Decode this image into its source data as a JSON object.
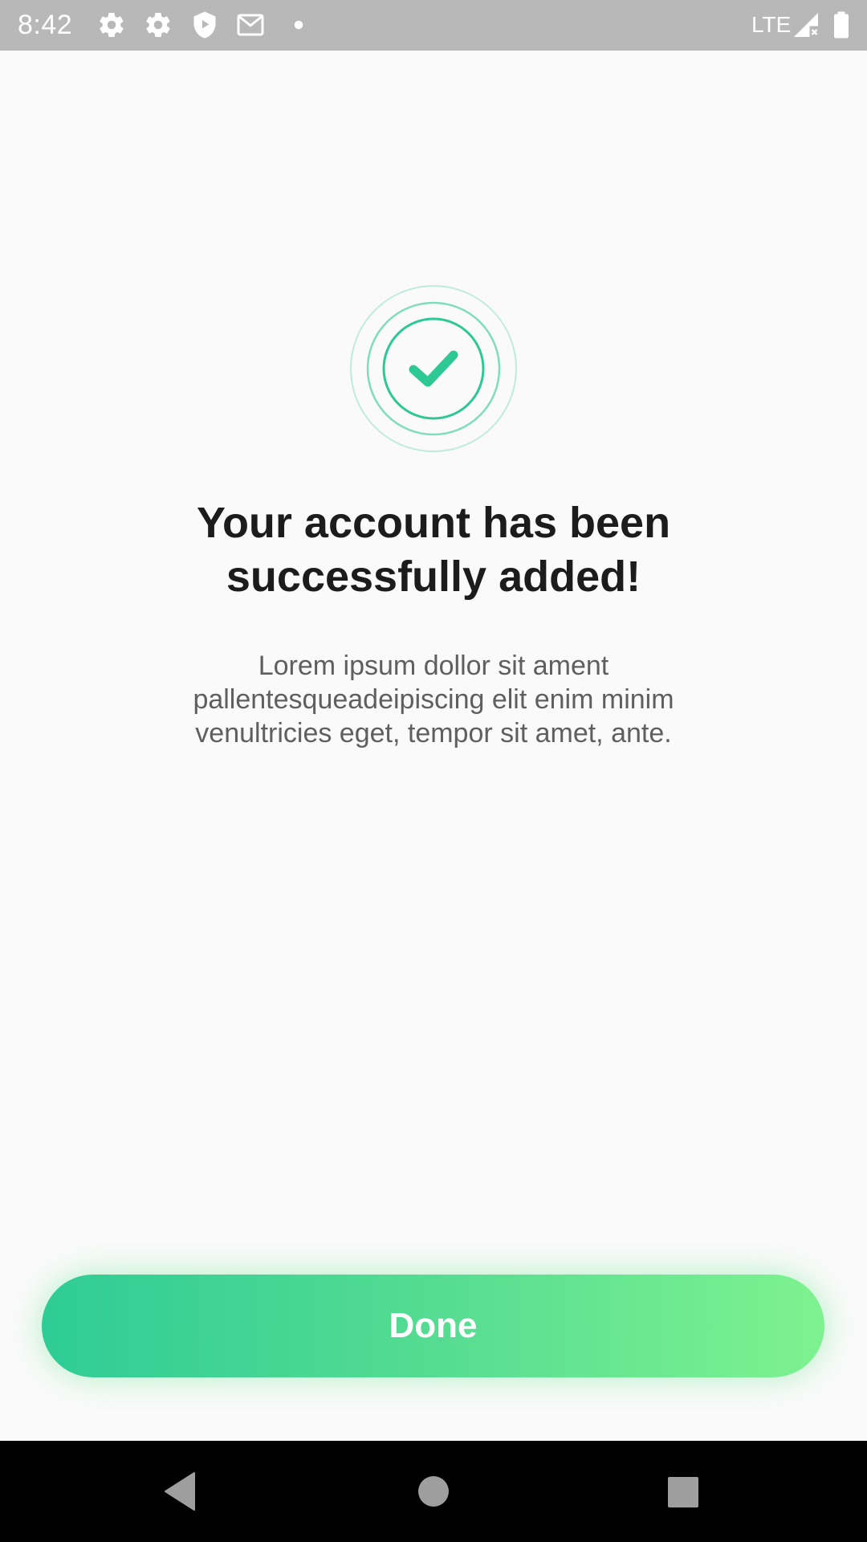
{
  "status_bar": {
    "time": "8:42",
    "network": "LTE",
    "icons": [
      "settings-icon",
      "settings-icon",
      "shield-play-icon",
      "gmail-icon",
      "notification-dot-icon",
      "signal-icon",
      "battery-icon"
    ]
  },
  "success": {
    "icon": "check-circle-icon",
    "accent_color": "#2ec894",
    "title_line1": "Your account has been",
    "title_line2": "successfully added!",
    "description_line1": "Lorem ipsum dollor sit ament",
    "description_line2": "pallentesqueadeipiscing elit enim minim",
    "description_line3": "venultricies eget, tempor sit amet, ante."
  },
  "actions": {
    "done_label": "Done",
    "gradient_start": "#2ecc96",
    "gradient_end": "#7ef290"
  },
  "navigation": {
    "buttons": [
      "back-icon",
      "home-icon",
      "recents-icon"
    ]
  }
}
